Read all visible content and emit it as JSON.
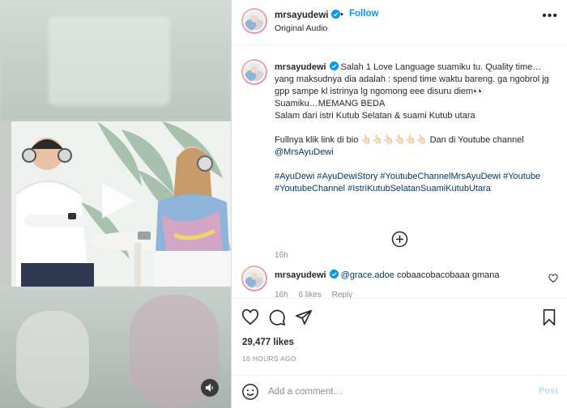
{
  "post": {
    "username": "mrsayudewi",
    "follow_label": "Follow",
    "dot": "•",
    "audio_label": "Original Audio",
    "more_label": "•••"
  },
  "caption": {
    "username": "mrsayudewi",
    "line1": "Salah 1 Love Language suamiku tu. Quality time… yang maksudnya dia adalah : spend time waktu bareng. ga ngobrol jg gpp sampe kl istrinya lg ngomong eee disuru diem👀",
    "line2": "Suamiku…MEMANG BEDA",
    "line3": "Salam dari istri Kutub Selatan & suami Kutub utara",
    "line4_prefix": "Fullnya klik link di bio 👆🏻👆🏻👆🏻👆🏻👆🏻👆🏻 Dan di Youtube channel",
    "channel": "@MrsAyuDewi",
    "hashtags": "#AyuDewi #AyuDewiStory #YoutubeChannelMrsAyuDewi #Youtube #YoutubeChannel #IstriKutubSelatanSuamiKutubUtara",
    "time": "16h"
  },
  "comment": {
    "username": "mrsayudewi",
    "mention": "@grace.adoe",
    "text": "cobaacobacobaaa gmana",
    "time": "16h",
    "likes": "6 likes",
    "reply": "Reply"
  },
  "stats": {
    "likes": "29,477 likes",
    "posted_ago": "16 HOURS AGO"
  },
  "comment_box": {
    "placeholder": "Add a comment…",
    "post_label": "Post"
  },
  "icons": {
    "verified": "verified-badge-icon",
    "heart": "heart-icon",
    "comment": "comment-icon",
    "share": "paper-plane-icon",
    "save": "bookmark-icon",
    "emoji": "smiley-icon",
    "load_more": "plus-circle-icon",
    "play": "play-icon",
    "mute": "speaker-icon"
  },
  "colors": {
    "link_blue": "#0095f6",
    "hashtag_navy": "#00376b",
    "muted_gray": "#8e8e8e",
    "post_disabled": "#b2dffc"
  }
}
